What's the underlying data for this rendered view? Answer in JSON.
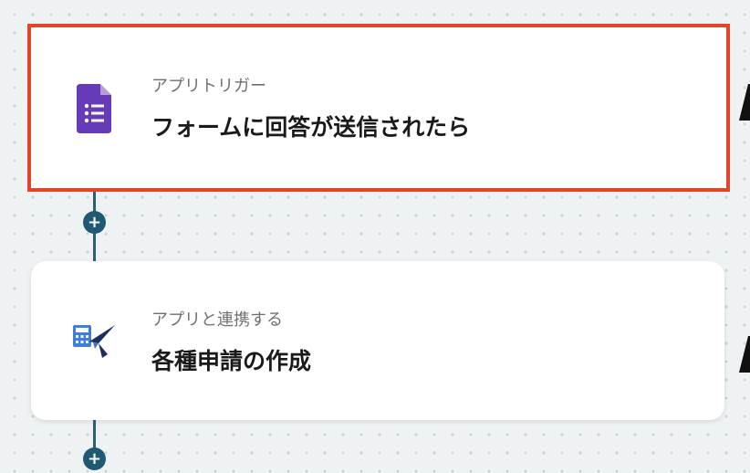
{
  "flow": {
    "steps": [
      {
        "type_label": "アプリトリガー",
        "title": "フォームに回答が送信されたら",
        "icon": "google-forms-icon",
        "selected": true
      },
      {
        "type_label": "アプリと連携する",
        "title": "各種申請の作成",
        "icon": "expense-app-icon",
        "selected": false
      }
    ],
    "add_step_label": "+"
  },
  "colors": {
    "selection_border": "#e2452c",
    "connector": "#2e5f73",
    "add_button": "#1f5a72",
    "forms_purple": "#673ab7"
  }
}
